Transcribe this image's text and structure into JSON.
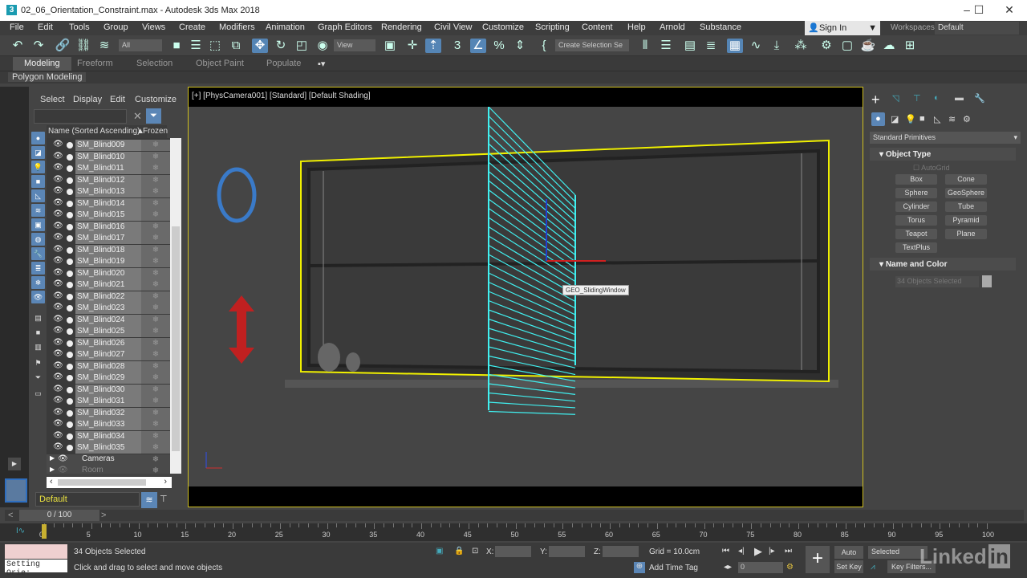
{
  "window": {
    "title": "02_06_Orientation_Constraint.max - Autodesk 3ds Max 2018",
    "app_icon": "3",
    "min": "–",
    "max": "☐",
    "close": "✕"
  },
  "menu": [
    "File",
    "Edit",
    "Tools",
    "Group",
    "Views",
    "Create",
    "Modifiers",
    "Animation",
    "Graph Editors",
    "Rendering",
    "Civil View",
    "Customize",
    "Scripting",
    "Content",
    "Help",
    "Arnold",
    "Substance"
  ],
  "account": {
    "sign_in": "Sign In",
    "workspaces_label": "Workspaces:",
    "workspace": "Default"
  },
  "toolbar": {
    "selection_filter": "All",
    "ref_coord": "View",
    "named_selection": "Create Selection Se"
  },
  "ribbon": {
    "tabs": [
      "Modeling",
      "Freeform",
      "Selection",
      "Object Paint",
      "Populate"
    ],
    "active": "Modeling",
    "sub": "Polygon Modeling"
  },
  "explorer": {
    "menu": [
      "Select",
      "Display",
      "Edit",
      "Customize"
    ],
    "search_value": "",
    "col_name": "Name (Sorted Ascending)",
    "col_frozen": "Frozen",
    "sort_icon": "▲",
    "items": [
      "SM_Blind009",
      "SM_Blind010",
      "SM_Blind011",
      "SM_Blind012",
      "SM_Blind013",
      "SM_Blind014",
      "SM_Blind015",
      "SM_Blind016",
      "SM_Blind017",
      "SM_Blind018",
      "SM_Blind019",
      "SM_Blind020",
      "SM_Blind021",
      "SM_Blind022",
      "SM_Blind023",
      "SM_Blind024",
      "SM_Blind025",
      "SM_Blind026",
      "SM_Blind027",
      "SM_Blind028",
      "SM_Blind029",
      "SM_Blind030",
      "SM_Blind031",
      "SM_Blind032",
      "SM_Blind033",
      "SM_Blind034",
      "SM_Blind035"
    ],
    "groups": [
      "Cameras",
      "Room"
    ],
    "layer": "Default"
  },
  "viewport": {
    "label": "[+] [PhysCamera001] [Standard] [Default Shading]",
    "tooltip": "GEO_SlidingWindow",
    "colors": {
      "selection": "#f0f000",
      "blinds": "#40f0f0",
      "rotate_icon": "#3a7ac8",
      "move_arrow": "#d02020"
    }
  },
  "command_panel": {
    "category": "Standard Primitives",
    "object_type": "Object Type",
    "autogrid": "AutoGrid",
    "buttons": [
      "Box",
      "Cone",
      "Sphere",
      "GeoSphere",
      "Cylinder",
      "Tube",
      "Torus",
      "Pyramid",
      "Teapot",
      "Plane",
      "TextPlus"
    ],
    "name_color": "Name and Color",
    "name_value": "34 Objects Selected"
  },
  "timeline": {
    "frame": "0 / 100",
    "prev": "<",
    "next": ">",
    "ticks": [
      "0",
      "5",
      "10",
      "15",
      "20",
      "25",
      "30",
      "35",
      "40",
      "45",
      "50",
      "55",
      "60",
      "65",
      "70",
      "75",
      "80",
      "85",
      "90",
      "95",
      "100"
    ],
    "current": 0
  },
  "status": {
    "maxscript": "Setting Orie:",
    "selected": "34 Objects Selected",
    "prompt": "Click and drag to select and move objects",
    "x": "X:",
    "y": "Y:",
    "z": "Z:",
    "grid": "Grid = 10.0cm",
    "add_time_tag": "Add Time Tag",
    "frame_value": "0",
    "auto_key": "Auto Key",
    "set_key": "Set Key",
    "key_mode": "Selected",
    "key_filters": "Key Filters..."
  },
  "watermark": "Linked in"
}
